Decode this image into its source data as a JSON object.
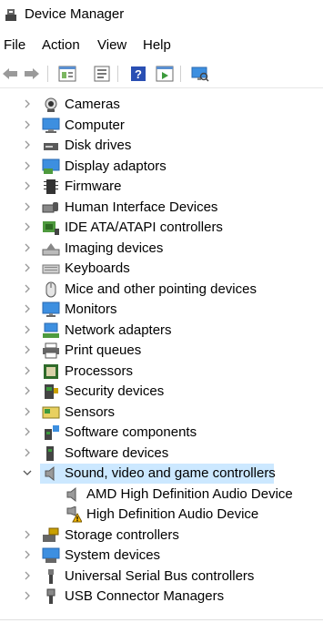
{
  "window": {
    "title": "Device Manager"
  },
  "menubar": {
    "items": [
      "File",
      "Action",
      "View",
      "Help"
    ]
  },
  "toolbar": {
    "buttons": [
      "back-icon",
      "forward-icon",
      "properties-icon",
      "update-driver-icon",
      "help-icon",
      "run-icon",
      "scan-hardware-icon"
    ]
  },
  "tree": {
    "categories": [
      {
        "label": "Cameras",
        "icon": "camera-icon"
      },
      {
        "label": "Computer",
        "icon": "computer-icon"
      },
      {
        "label": "Disk drives",
        "icon": "disk-drive-icon"
      },
      {
        "label": "Display adaptors",
        "icon": "display-adapter-icon"
      },
      {
        "label": "Firmware",
        "icon": "firmware-icon"
      },
      {
        "label": "Human Interface Devices",
        "icon": "hid-icon"
      },
      {
        "label": "IDE ATA/ATAPI controllers",
        "icon": "ide-controller-icon"
      },
      {
        "label": "Imaging devices",
        "icon": "imaging-device-icon"
      },
      {
        "label": "Keyboards",
        "icon": "keyboard-icon"
      },
      {
        "label": "Mice and other pointing devices",
        "icon": "mouse-icon"
      },
      {
        "label": "Monitors",
        "icon": "monitor-icon"
      },
      {
        "label": "Network adapters",
        "icon": "network-adapter-icon"
      },
      {
        "label": "Print queues",
        "icon": "printer-icon"
      },
      {
        "label": "Processors",
        "icon": "processor-icon"
      },
      {
        "label": "Security devices",
        "icon": "security-device-icon"
      },
      {
        "label": "Sensors",
        "icon": "sensor-icon"
      },
      {
        "label": "Software components",
        "icon": "software-component-icon"
      },
      {
        "label": "Software devices",
        "icon": "software-device-icon"
      },
      {
        "label": "Sound, video and game controllers",
        "icon": "speaker-icon",
        "expanded": true,
        "selected": true
      },
      {
        "label": "Storage controllers",
        "icon": "storage-controller-icon"
      },
      {
        "label": "System devices",
        "icon": "system-device-icon"
      },
      {
        "label": "Universal Serial Bus controllers",
        "icon": "usb-icon"
      },
      {
        "label": "USB Connector Managers",
        "icon": "usb-connector-icon"
      }
    ],
    "sound_children": [
      {
        "label": "AMD High Definition Audio Device",
        "icon": "speaker-icon",
        "warning": false
      },
      {
        "label": "High Definition Audio Device",
        "icon": "speaker-warning-icon",
        "warning": true
      }
    ]
  },
  "colors": {
    "selection": "#cce8ff",
    "accent": "#1e7bd6",
    "warning": "#f2b600"
  }
}
